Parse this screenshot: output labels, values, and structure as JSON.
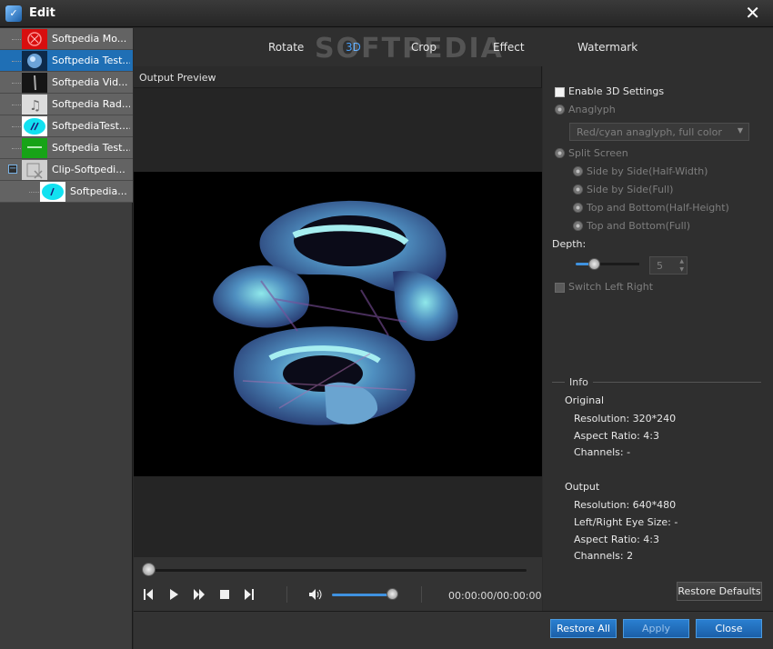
{
  "window": {
    "title": "Edit",
    "close_glyph": "✕"
  },
  "clips": [
    {
      "label": "Softpedia Mo...",
      "thumb_color": "#d80e0e",
      "selected": false
    },
    {
      "label": "Softpedia Test...",
      "thumb_color": "#2a5fa0",
      "selected": true
    },
    {
      "label": "Softpedia Vid...",
      "thumb_color": "#151515",
      "selected": false
    },
    {
      "label": "Softpedia Rad...",
      "thumb_color": "#dcdcdc",
      "selected": false
    },
    {
      "label": "SoftpediaTest....",
      "thumb_color": "#12e1f0",
      "selected": false
    },
    {
      "label": "Softpedia Test...",
      "thumb_color": "#17a317",
      "selected": false
    },
    {
      "label": "Clip-Softpedi...",
      "thumb_color": "#cfcfcf",
      "selected": false,
      "expander": "−"
    },
    {
      "label": "Softpedia...",
      "thumb_color": "#12e1f0",
      "selected": false,
      "child": true
    }
  ],
  "tabs": [
    {
      "label": "Rotate",
      "active": false
    },
    {
      "label": "3D",
      "active": true
    },
    {
      "label": "Crop",
      "active": false
    },
    {
      "label": "Effect",
      "active": false
    },
    {
      "label": "Watermark",
      "active": false
    }
  ],
  "watermark_text": "SOFTPEDIA",
  "preview": {
    "label": "Output Preview"
  },
  "player": {
    "time": "00:00:00/00:00:00",
    "seek_fraction": 0,
    "volume_fraction": 0.95
  },
  "settings": {
    "enable_3d": "Enable 3D Settings",
    "anaglyph": "Anaglyph",
    "anaglyph_option": "Red/cyan anaglyph, full color",
    "split_screen": "Split Screen",
    "split_options": [
      "Side by Side(Half-Width)",
      "Side by Side(Full)",
      "Top and Bottom(Half-Height)",
      "Top and Bottom(Full)"
    ],
    "depth_label": "Depth:",
    "depth_value": "5",
    "switch_lr": "Switch Left Right"
  },
  "info": {
    "title": "Info",
    "original_title": "Original",
    "original": [
      "Resolution: 320*240",
      "Aspect Ratio: 4:3",
      "Channels: -"
    ],
    "output_title": "Output",
    "output": [
      "Resolution: 640*480",
      "Left/Right Eye Size: -",
      "Aspect Ratio: 4:3",
      "Channels: 2"
    ]
  },
  "buttons": {
    "restore_defaults": "Restore Defaults",
    "restore_all": "Restore All",
    "apply": "Apply",
    "close": "Close"
  }
}
